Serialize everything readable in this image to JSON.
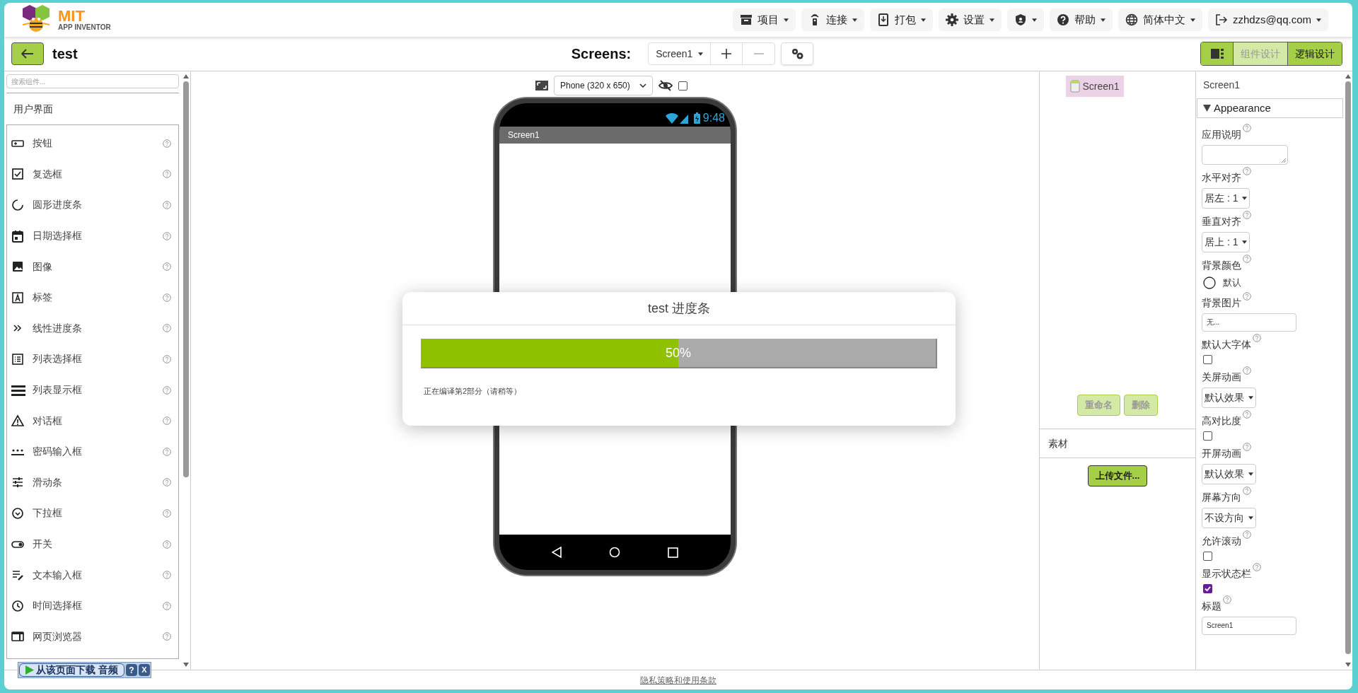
{
  "header": {
    "logo": {
      "title": "MIT",
      "subtitle": "APP INVENTOR"
    },
    "menus": [
      {
        "kind": "text",
        "label": "项目"
      },
      {
        "kind": "text",
        "label": "连接"
      },
      {
        "kind": "text",
        "label": "打包"
      },
      {
        "kind": "text",
        "label": "设置"
      },
      {
        "kind": "icon"
      },
      {
        "kind": "text",
        "label": "帮助"
      },
      {
        "kind": "text",
        "label": "简体中文"
      },
      {
        "kind": "text",
        "label": "zzhdzs@qq.com"
      }
    ]
  },
  "toolbar": {
    "project": "test",
    "screens_label": "Screens:",
    "screen": "Screen1",
    "remove_disabled": true,
    "modes": [
      {
        "label": "组件设计",
        "selected": true
      },
      {
        "label": "逻辑设计",
        "selected": false
      }
    ]
  },
  "palette": {
    "search_placeholder": "搜索组件...",
    "category": "用户界面",
    "items": [
      "按钮",
      "复选框",
      "圆形进度条",
      "日期选择框",
      "图像",
      "标签",
      "线性进度条",
      "列表选择框",
      "列表显示框",
      "对话框",
      "密码输入框",
      "滑动条",
      "下拉框",
      "开关",
      "文本输入框",
      "时间选择框",
      "网页浏览器"
    ]
  },
  "viewer": {
    "device": "Phone (320 x 650)",
    "hidden_checked": false,
    "phone": {
      "time": "9:48",
      "title": "Screen1"
    }
  },
  "dialog": {
    "title": "test 进度条",
    "level": 0.5,
    "reading": "50%",
    "message": "正在编译第2部分（请稍等）"
  },
  "components": {
    "tree": [
      {
        "label": "Screen1",
        "selected": true
      }
    ],
    "buttons": [
      {
        "label": "重命名",
        "disabled": true
      },
      {
        "label": "删除",
        "disabled": true
      }
    ],
    "media_title": "素材",
    "upload": "上传文件..."
  },
  "properties": {
    "component": "Screen1",
    "section": {
      "label": "Appearance",
      "expanded": true
    },
    "items": [
      {
        "kind": "textarea",
        "label": "应用说明"
      },
      {
        "kind": "dropdown",
        "label": "水平对齐",
        "value": "居左 : 1"
      },
      {
        "kind": "dropdown",
        "label": "垂直对齐",
        "value": "居上 : 1"
      },
      {
        "kind": "color",
        "label": "背景颜色",
        "value": "默认"
      },
      {
        "kind": "text",
        "label": "背景图片",
        "value": "无..."
      },
      {
        "kind": "checkbox",
        "label": "默认大字体",
        "checked": false
      },
      {
        "kind": "dropdown",
        "label": "关屏动画",
        "value": "默认效果"
      },
      {
        "kind": "checkbox",
        "label": "高对比度",
        "checked": false
      },
      {
        "kind": "dropdown",
        "label": "开屏动画",
        "value": "默认效果"
      },
      {
        "kind": "dropdown",
        "label": "屏幕方向",
        "value": "不设方向"
      },
      {
        "kind": "checkbox",
        "label": "允许滚动",
        "checked": false
      },
      {
        "kind": "checkbox",
        "label": "显示状态栏",
        "checked": true
      },
      {
        "kind": "text",
        "label": "标题",
        "value": "Screen1"
      }
    ]
  },
  "footer": {
    "link": "隐私策略和使用条款"
  },
  "download_bar": {
    "label": "从该页面下载 音频",
    "help": "?",
    "close": "X"
  }
}
